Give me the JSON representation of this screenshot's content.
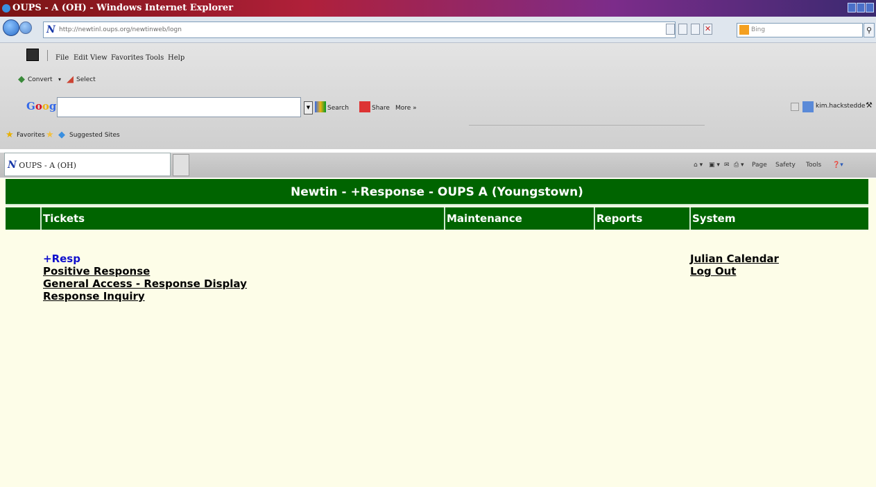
{
  "window": {
    "title": "OUPS - A (OH) - Windows Internet Explorer"
  },
  "address_bar": {
    "url": "http://newtinl.oups.org/newtinweb/logn",
    "search_placeholder": "Bing",
    "search_icon": "magnifier-icon"
  },
  "menu": {
    "items": [
      "File",
      "Edit",
      "View",
      "Favorites",
      "Tools",
      "Help"
    ]
  },
  "convert_toolbar": {
    "convert_label": "Convert",
    "select_label": "Select"
  },
  "google_toolbar": {
    "logo": "Google",
    "search_label": "Search",
    "share_label": "Share",
    "more_label": "More »",
    "user_label": "kim.hackstedde"
  },
  "favorites_bar": {
    "favorites_label": "Favorites",
    "suggested_label": "Suggested Sites"
  },
  "tab": {
    "icon_letter": "N",
    "title": "OUPS - A (OH)"
  },
  "command_bar": {
    "page_label": "Page",
    "safety_label": "Safety",
    "tools_label": "Tools"
  },
  "app": {
    "banner_title": "Newtin - +Response - OUPS A (Youngstown)",
    "nav": [
      "Tickets",
      "Maintenance",
      "Reports",
      "System"
    ],
    "ticket_links": [
      "+Resp",
      "Positive Response",
      "General Access - Response Display",
      "Response Inquiry"
    ],
    "system_links": [
      "Julian Calendar",
      "Log Out"
    ]
  },
  "colors": {
    "banner_green": "#006400",
    "page_bg": "#fdfde8",
    "active_link": "#1010cc"
  }
}
